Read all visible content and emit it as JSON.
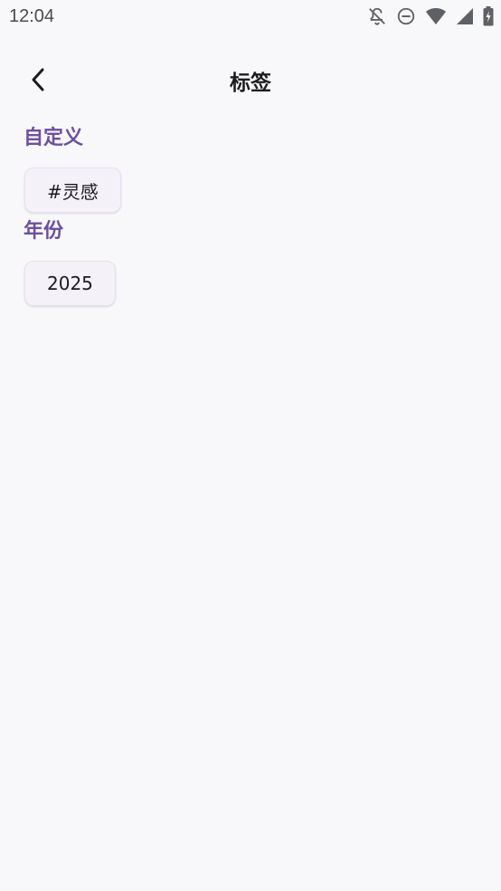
{
  "status_bar": {
    "time": "12:04",
    "icons": [
      "notifications-off-icon",
      "do-not-disturb-icon",
      "wifi-icon",
      "cell-signal-icon",
      "battery-charging-icon"
    ]
  },
  "app_bar": {
    "back_icon": "chevron-left-icon",
    "title": "标签"
  },
  "sections": [
    {
      "title": "自定义",
      "chips": [
        "#灵感"
      ]
    },
    {
      "title": "年份",
      "chips": [
        "2025"
      ]
    }
  ],
  "colors": {
    "background": "#f8f8fb",
    "section_title": "#6c4fa3",
    "chip_background": "#f5f1f9"
  }
}
